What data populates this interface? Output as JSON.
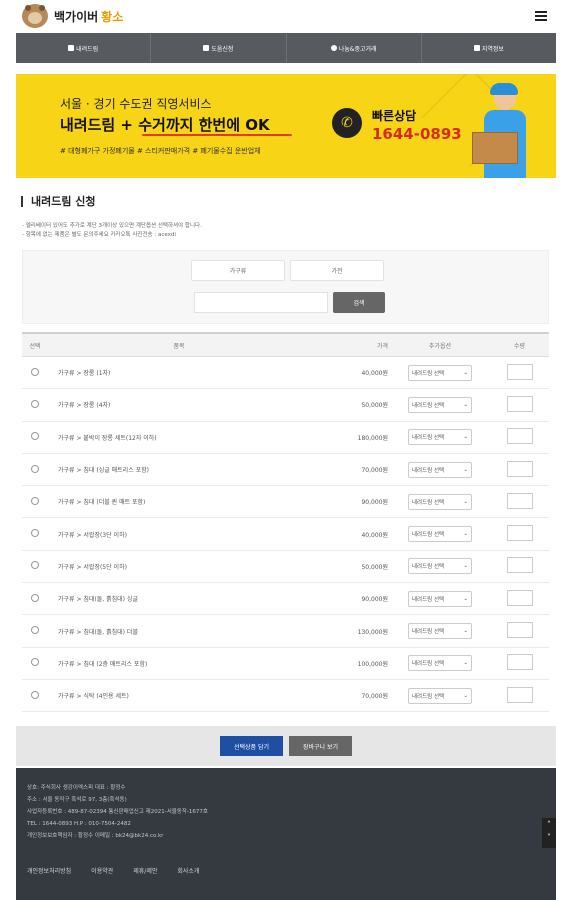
{
  "header": {
    "logo_text": "백가이버",
    "logo_accent": "황소"
  },
  "nav": [
    {
      "label": "내려드림",
      "icon": "truck-icon"
    },
    {
      "label": "도움신청",
      "icon": "edit-icon"
    },
    {
      "label": "나눔&중고거래",
      "icon": "circle-icon"
    },
    {
      "label": "지역정보",
      "icon": "map-icon"
    }
  ],
  "banner": {
    "line1": "서울 · 경기 수도권 직영서비스",
    "line2": "내려드림 + 수거까지 한번에 OK",
    "tags": "# 대형폐가구 가정폐기물   # 스티커판매가격   # 폐기물수집 운반업체",
    "consult_label": "빠른상담",
    "phone": "1644-0893"
  },
  "content": {
    "title": "내려드림 신청",
    "notes": [
      "- 엘리베이터 있어도 추가로 계단 3개이상 있으면 계단옵션 선택하셔야 합니다.",
      "- 항목에 없는 제품은 별도 문의주세요 카카오톡 사진전송 : acexdi"
    ],
    "search": {
      "tab1": "가구류",
      "tab2": "가전",
      "placeholder": "",
      "button": "검색"
    },
    "table": {
      "headers": {
        "select": "선택",
        "item": "품목",
        "price": "가격",
        "option": "추가옵션",
        "qty": "수량"
      },
      "option_default": "내려드림 선택",
      "rows": [
        {
          "item": "가구류 > 장롱 (1자)",
          "price": "40,000원"
        },
        {
          "item": "가구류 > 장롱 (4자)",
          "price": "50,000원"
        },
        {
          "item": "가구류 > 붙박이 장롱 세트(12자 이하)",
          "price": "180,000원"
        },
        {
          "item": "가구류 > 침대 (싱글 매트리스 포함)",
          "price": "70,000원"
        },
        {
          "item": "가구류 > 침대 (더블 퀸 매트 포함)",
          "price": "90,000원"
        },
        {
          "item": "가구류 > 서랍장(3단 이하)",
          "price": "40,000원"
        },
        {
          "item": "가구류 > 서랍장(5단 이하)",
          "price": "50,000원"
        },
        {
          "item": "가구류 > 침대(돌, 흙침대) 싱글",
          "price": "90,000원"
        },
        {
          "item": "가구류 > 침대(돌, 흙침대) 더블",
          "price": "130,000원"
        },
        {
          "item": "가구류 > 침대 (2층 매트리스 포함)",
          "price": "100,000원"
        },
        {
          "item": "가구류 > 식탁 (4인용 세트)",
          "price": "70,000원"
        }
      ]
    }
  },
  "actions": {
    "primary": "선택상품 담기",
    "secondary": "장바구니 보기"
  },
  "footer": {
    "info": [
      "상호: 주식회사 생강이엑스피 대표 : 황정수",
      "주소 : 서울 동작구 흑석로 97, 3층(흑석동)",
      "사업자등록번호 : 489-87-02394 통신판매업신고 제2021-서울동작-1677호",
      "TEL : 1644-0893 H.P : 010-7504-2482",
      "개인정보보호책임자 : 황정수 이메일 : bk24@bk24.co.kr"
    ],
    "links": [
      "개인정보처리방침",
      "이용약관",
      "제휴/제안",
      "회사소개"
    ]
  }
}
